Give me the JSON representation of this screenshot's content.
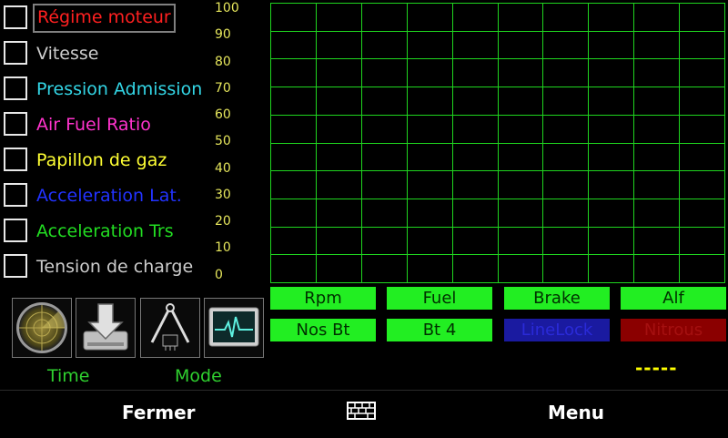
{
  "channels": [
    {
      "label": "Régime moteur",
      "color": "#ff2020",
      "selected": true
    },
    {
      "label": "Vitesse",
      "color": "#cccccc"
    },
    {
      "label": "Pression Admission",
      "color": "#33d6e6"
    },
    {
      "label": "Air Fuel Ratio",
      "color": "#ff33cc"
    },
    {
      "label": "Papillon de gaz",
      "color": "#ffff33"
    },
    {
      "label": "Acceleration Lat.",
      "color": "#2233ff"
    },
    {
      "label": "Acceleration Trs",
      "color": "#22dd22"
    },
    {
      "label": "Tension de charge",
      "color": "#cccccc"
    }
  ],
  "y_axis": {
    "ticks": [
      "100",
      "90",
      "80",
      "70",
      "60",
      "50",
      "40",
      "30",
      "20",
      "10",
      "0"
    ],
    "color": "#e6e65c"
  },
  "grid": {
    "color": "#1fd51f",
    "columns": 10,
    "rows": 10
  },
  "buttons": {
    "rpm": "Rpm",
    "fuel": "Fuel",
    "brake": "Brake",
    "alf": "Alf",
    "nos_bt": "Nos Bt",
    "bt4": "Bt 4",
    "linelock": "LineLock",
    "nitrous": "Nitrous",
    "active_color": "#22ee22",
    "linelock_color": "#1a1aa0",
    "nitrous_color": "#8b0000"
  },
  "tiles": [
    "radar-icon",
    "download-drive-icon",
    "caliper-chip-icon",
    "heartbeat-monitor-icon"
  ],
  "labels": {
    "time": "Time",
    "mode": "Mode",
    "dash": "-----"
  },
  "bottom": {
    "close": "Fermer",
    "menu": "Menu"
  }
}
